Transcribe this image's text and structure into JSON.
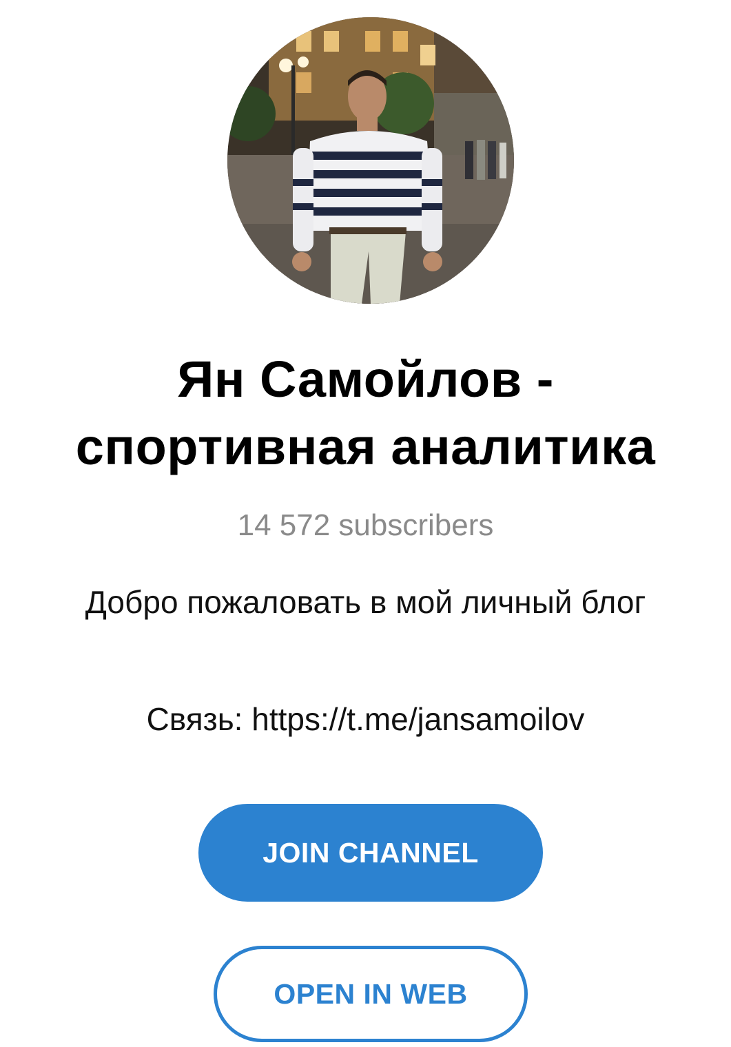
{
  "channel": {
    "title_line1": "Ян Самойлов -",
    "title_line2": "спортивная аналитика",
    "subscribers": "14 572 subscribers",
    "description_line1": "Добро пожаловать в мой личный блог",
    "description_line2": "Связь: https://t.me/jansamoilov"
  },
  "actions": {
    "join_label": "JOIN CHANNEL",
    "open_web_label": "OPEN IN WEB"
  },
  "colors": {
    "accent": "#2c82d0",
    "secondary_text": "#8a8a8a"
  }
}
